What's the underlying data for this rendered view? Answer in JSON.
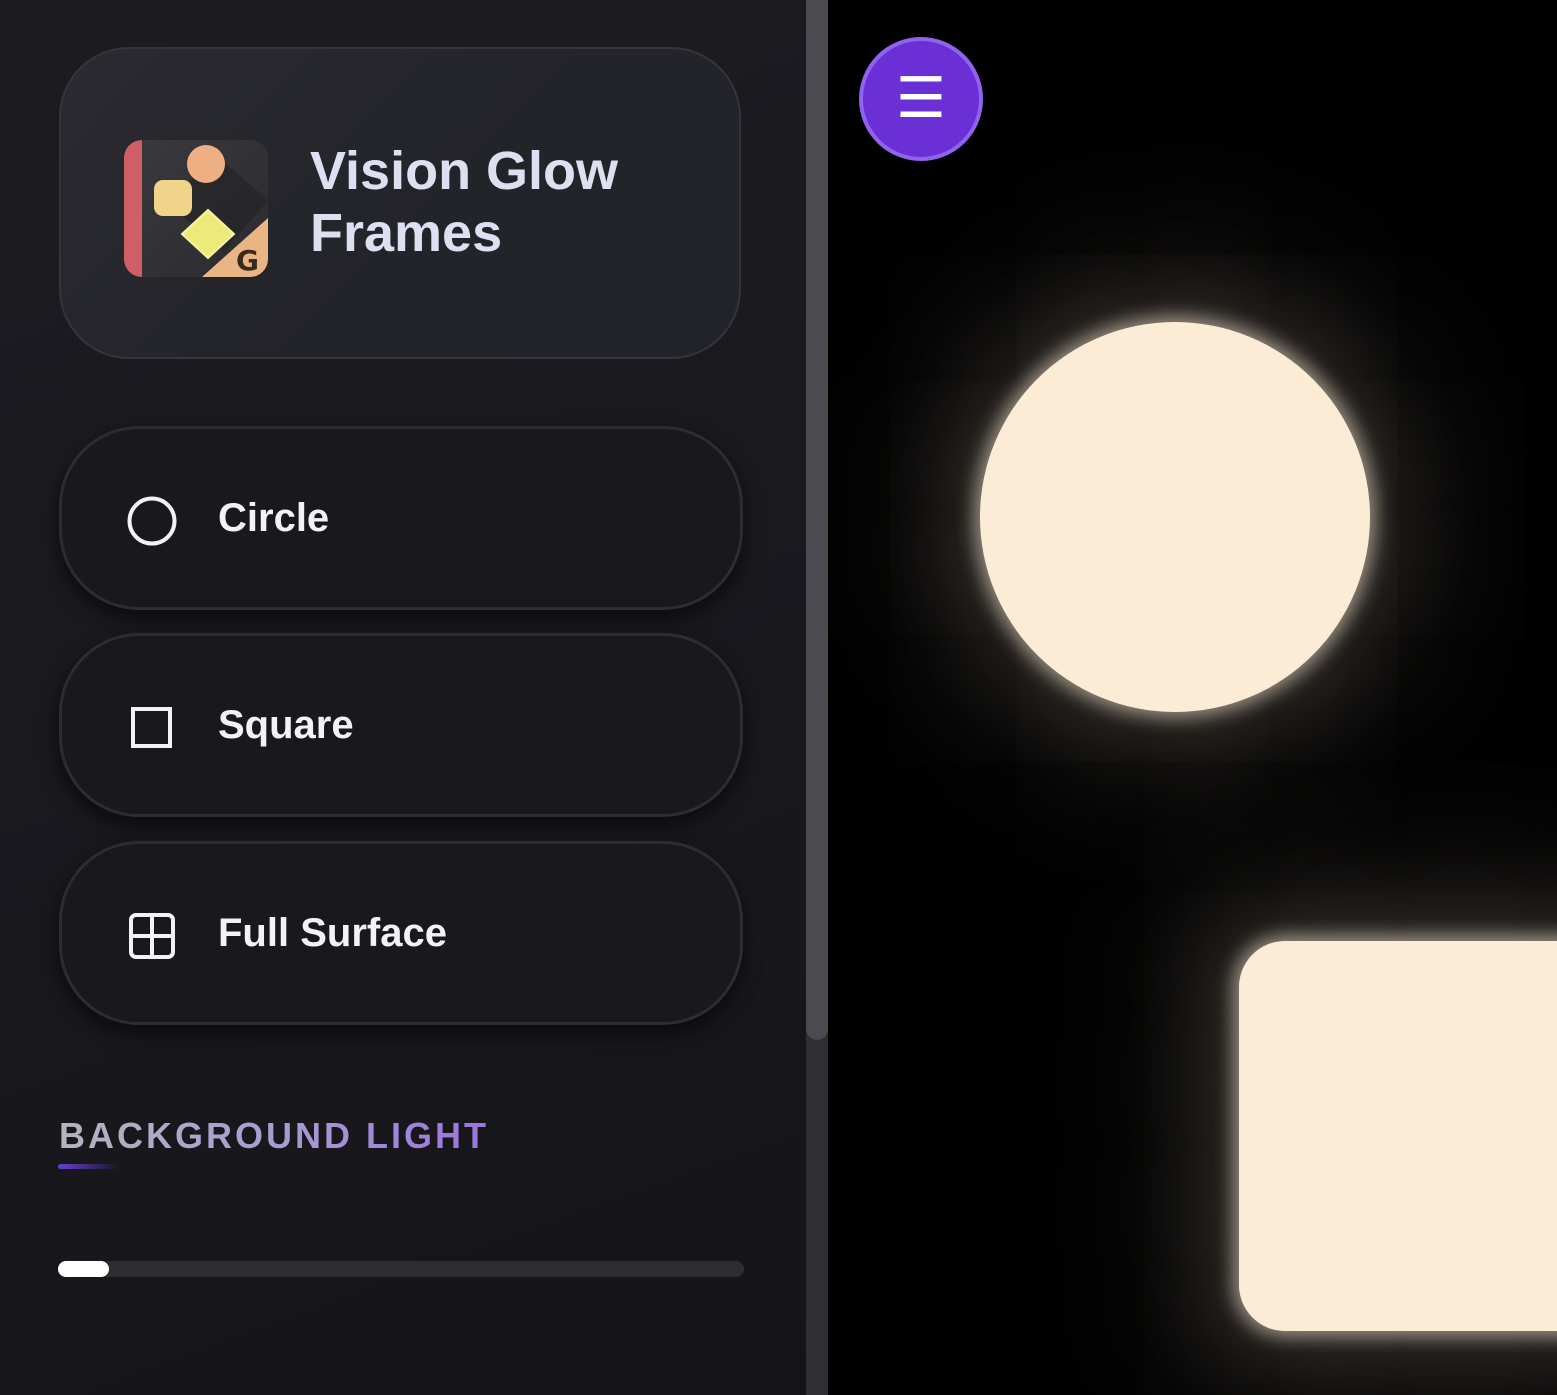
{
  "app": {
    "title": "Vision Glow Frames",
    "icon_name": "vision-glow-frames-app-icon"
  },
  "modes": [
    {
      "label": "Circle",
      "icon": "circle-outline-icon"
    },
    {
      "label": "Square",
      "icon": "square-outline-icon"
    },
    {
      "label": "Full Surface",
      "icon": "grid-icon"
    }
  ],
  "background_light": {
    "heading": "BACKGROUND LIGHT",
    "level_fraction": 0.075
  },
  "menu": {
    "glyph": "☰",
    "icon_name": "hamburger-menu-icon"
  },
  "glow": {
    "color": "#fdecd5",
    "shapes": [
      "circle",
      "rounded-square"
    ]
  },
  "colors": {
    "accent": "#6b2fd6",
    "sidebar_bg": "#18181d",
    "canvas_bg": "#000000"
  }
}
